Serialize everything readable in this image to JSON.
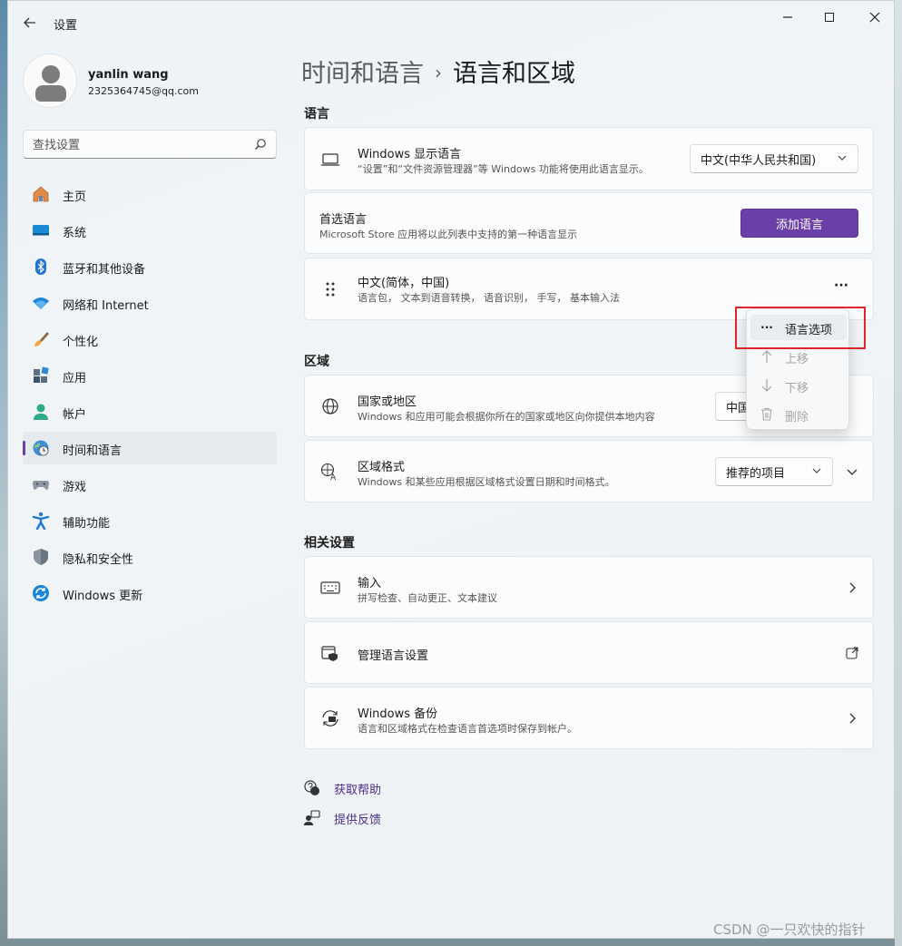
{
  "window": {
    "title": "设置",
    "controls": {
      "minimize": "—",
      "close": "✕"
    }
  },
  "profile": {
    "name": "yanlin wang",
    "email": "2325364745@qq.com"
  },
  "search": {
    "placeholder": "查找设置"
  },
  "nav": {
    "items": [
      {
        "label": "主页",
        "icon": "home-icon"
      },
      {
        "label": "系统",
        "icon": "system-icon"
      },
      {
        "label": "蓝牙和其他设备",
        "icon": "bluetooth-icon"
      },
      {
        "label": "网络和 Internet",
        "icon": "wifi-icon"
      },
      {
        "label": "个性化",
        "icon": "brush-icon"
      },
      {
        "label": "应用",
        "icon": "apps-icon"
      },
      {
        "label": "帐户",
        "icon": "account-icon"
      },
      {
        "label": "时间和语言",
        "icon": "time-language-icon",
        "active": true
      },
      {
        "label": "游戏",
        "icon": "gaming-icon"
      },
      {
        "label": "辅助功能",
        "icon": "accessibility-icon"
      },
      {
        "label": "隐私和安全性",
        "icon": "shield-icon"
      },
      {
        "label": "Windows 更新",
        "icon": "update-icon"
      }
    ]
  },
  "breadcrumb": {
    "parent": "时间和语言",
    "separator": "›",
    "current": "语言和区域"
  },
  "language_section": {
    "title": "语言",
    "display_language": {
      "title": "Windows 显示语言",
      "subtitle": "“设置”和“文件资源管理器”等 Windows 功能将使用此语言显示。",
      "value": "中文(中华人民共和国)"
    },
    "preferred": {
      "title": "首选语言",
      "subtitle": "Microsoft Store 应用将以此列表中支持的第一种语言显示",
      "button": "添加语言"
    },
    "item": {
      "title": "中文(简体，中国)",
      "subtitle": "语言包， 文本到语音转换， 语音识别， 手写， 基本输入法",
      "more": "···"
    }
  },
  "context_menu": {
    "items": [
      {
        "label": "语言选项",
        "icon": "more-icon",
        "enabled": true
      },
      {
        "label": "上移",
        "icon": "arrow-up-icon",
        "enabled": false
      },
      {
        "label": "下移",
        "icon": "arrow-down-icon",
        "enabled": false
      },
      {
        "label": "删除",
        "icon": "trash-icon",
        "enabled": false
      }
    ],
    "more_glyph": "···"
  },
  "region_section": {
    "title": "区域",
    "country": {
      "title": "国家或地区",
      "subtitle": "Windows 和应用可能会根据你所在的国家或地区向你提供本地内容",
      "value": "中国"
    },
    "format": {
      "title": "区域格式",
      "subtitle": "Windows 和某些应用根据区域格式设置日期和时间格式。",
      "value": "推荐的项目"
    }
  },
  "related_section": {
    "title": "相关设置",
    "input": {
      "title": "输入",
      "subtitle": "拼写检查、自动更正、文本建议"
    },
    "manage": {
      "title": "管理语言设置"
    },
    "backup": {
      "title": "Windows 备份",
      "subtitle": "语言和区域格式在检查语言首选项时保存到帐户。"
    }
  },
  "footer_links": {
    "help": "获取帮助",
    "feedback": "提供反馈"
  },
  "watermark": "CSDN @一只欢快的指针",
  "colors": {
    "accent": "#6a3fa7",
    "highlight_box": "#e0262b",
    "link": "#4a2d8a"
  }
}
